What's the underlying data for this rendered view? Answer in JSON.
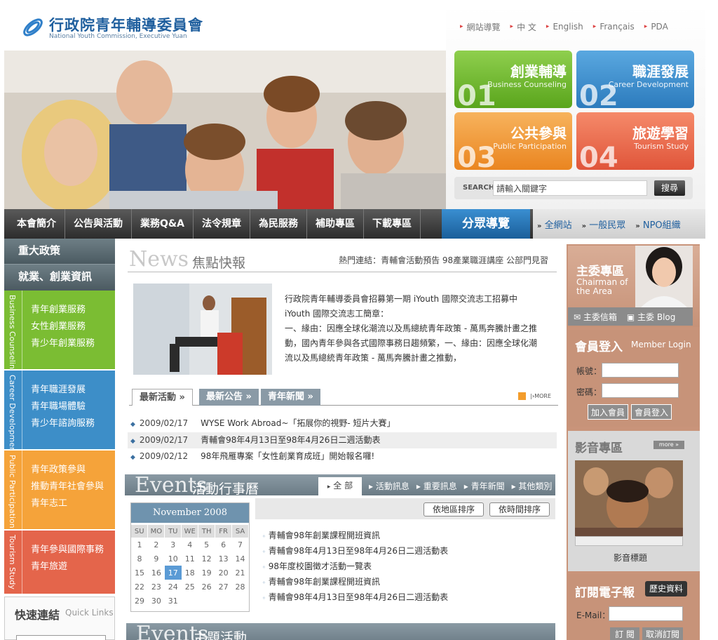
{
  "logo": {
    "zh": "行政院青年輔導委員會",
    "en": "National Youth Commission, Executive Yuan"
  },
  "topnav": [
    "網站導覽",
    "中  文",
    "English",
    "Français",
    "PDA"
  ],
  "tiles": [
    {
      "zh": "創業輔導",
      "en": "Business Counseling",
      "num": "01"
    },
    {
      "zh": "職涯發展",
      "en": "Career Development",
      "num": "02"
    },
    {
      "zh": "公共參與",
      "en": "Public Participation",
      "num": "03"
    },
    {
      "zh": "旅遊學習",
      "en": "Tourism Study",
      "num": "04"
    }
  ],
  "search": {
    "label": "SEARCH",
    "placeholder": "請輸入關鍵字",
    "button": "搜尋"
  },
  "mainnav": [
    "本會簡介",
    "公告與活動",
    "業務Q&A",
    "法令規章",
    "為民服務",
    "補助專區",
    "下載專區"
  ],
  "fenzhong": "分眾導覽",
  "audience": [
    "全網站",
    "一般民眾",
    "NPO組織"
  ],
  "left": {
    "policy": "重大政策",
    "employ": "就業、創業資訊",
    "sections": [
      {
        "side": "Business Counseling",
        "items": [
          "青年創業服務",
          "女性創業服務",
          "青少年創業服務"
        ]
      },
      {
        "side": "Career Development",
        "items": [
          "青年職涯發展",
          "青年職場體驗",
          "青少年諮詢服務"
        ]
      },
      {
        "side": "Public Participation",
        "items": [
          "青年政策參與",
          "推動青年社會參與",
          "青年志工"
        ]
      },
      {
        "side": "Tourism Study",
        "items": [
          "青年參與國際事務",
          "青年旅遊"
        ]
      }
    ],
    "quick": {
      "zh": "快速連結",
      "en": "Quick Links"
    }
  },
  "news": {
    "en": "News",
    "zh": "焦點快報",
    "hot": "熱門連結：青輔會活動預告   98產業職涯講座   公部門見習",
    "lines": [
      "行政院青年輔導委員會招募第一期 iYouth 國際交流志工招募中",
      "iYouth 國際交流志工簡章：",
      "一、緣由：因應全球化潮流以及馬總統青年政策 - 萬馬奔騰計畫之推",
      "動，國內青年參與各式國際事務日趨頻繁，一、緣由：因應全球化潮",
      "流以及馬總統青年政策 - 萬馬奔騰計畫之推動，"
    ],
    "tabs": [
      "最新活動 »",
      "最新公告 »",
      "青年新聞 »"
    ],
    "more": "MORE",
    "rows": [
      {
        "date": "2009/02/17",
        "title": "WYSE Work Abroad~「拓展你的視野- 短片大賽」"
      },
      {
        "date": "2009/02/17",
        "title": "青輔會98年4月13日至98年4月26日二週活動表"
      },
      {
        "date": "2009/02/12",
        "title": "98年飛雁專案「女性創業育成班」開始報名囉!"
      }
    ]
  },
  "events": {
    "en": "Events",
    "zh": "活動行事曆",
    "all": "全 部",
    "cats": [
      "活動訊息",
      "重要訊息",
      "青年新聞",
      "其他類別"
    ],
    "sort1": "依地區排序",
    "sort2": "依時間排序",
    "items": [
      "青輔會98年創業課程開班資訊",
      "青輔會98年4月13日至98年4月26日二週活動表",
      "98年度校園徵才活動一覽表",
      "青輔會98年創業課程開班資訊",
      "青輔會98年4月13日至98年4月26日二週活動表"
    ],
    "zh2": "主題活動"
  },
  "calendar": {
    "month": "November 2008",
    "days": [
      "SU",
      "MO",
      "TU",
      "WE",
      "TH",
      "FR",
      "SA"
    ],
    "weeks": [
      [
        "1",
        "2",
        "3",
        "4",
        "5",
        "6",
        "7"
      ],
      [
        "8",
        "9",
        "10",
        "11",
        "12",
        "13",
        "14"
      ],
      [
        "15",
        "16",
        "17",
        "18",
        "19",
        "20",
        "21"
      ],
      [
        "22",
        "23",
        "24",
        "25",
        "26",
        "27",
        "28"
      ],
      [
        "29",
        "30",
        "31",
        "",
        "",
        "",
        ""
      ]
    ],
    "selected": "17"
  },
  "right": {
    "chair": {
      "zh": "主委專區",
      "en1": "Chairman of",
      "en2": "the Area",
      "mail": "主委信箱",
      "blog": "主委 Blog"
    },
    "login": {
      "zh": "會員登入",
      "en": "Member Login",
      "account": "帳號：",
      "password": "密碼：",
      "join": "加入會員",
      "login": "會員登入"
    },
    "media": {
      "zh": "影音專區",
      "more": "more »",
      "caption": "影音標題"
    },
    "epaper": {
      "zh": "訂閱電子報",
      "hist": "歷史資料",
      "email": "E-Mail：",
      "sub": "訂 閱",
      "unsub": "取消訂閱"
    }
  },
  "colors": {
    "green": "#7bbd33",
    "blue": "#3d8ec8",
    "orange": "#f5a33a",
    "red": "#e4654b"
  }
}
